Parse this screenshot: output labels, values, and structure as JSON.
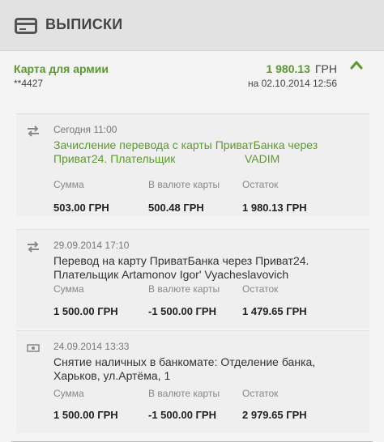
{
  "header": {
    "title": "ВЫПИСКИ",
    "icon": "credit-card-icon"
  },
  "account": {
    "name": "Карта для армии",
    "number": "**4427",
    "balance": "1 980.13",
    "currency": "ГРН",
    "date": "на 02.10.2014 12:56",
    "accent_color": "#5b9a2e"
  },
  "columns": {
    "sum": "Сумма",
    "card_currency": "В валюте карты",
    "rest": "Остаток"
  },
  "transactions": [
    {
      "icon": "transfer-arrows-icon",
      "date": "Сегодня 11:00",
      "desc1": "Зачисление перевода с карты ПриватБанка через",
      "desc2": "Приват24. Плательщик                      VADIM",
      "sum": "503.00 ГРН",
      "card_amount": "500.48 ГРН",
      "rest": "1 980.13 ГРН"
    },
    {
      "icon": "transfer-arrows-icon",
      "date": "29.09.2014 17:10",
      "desc1": "Перевод на карту ПриватБанка через Приват24.",
      "desc2": "Плательщик Artamonov Igor' Vyacheslavovich",
      "sum": "1 500.00 ГРН",
      "card_amount": "-1 500.00 ГРН",
      "rest": "1 479.65 ГРН"
    },
    {
      "icon": "cash-icon",
      "date": "24.09.2014 13:33",
      "desc1": "Снятие наличных в банкомате: Отделение банка,",
      "desc2": "Харьков, ул.Артёма, 1",
      "sum": "1 500.00 ГРН",
      "card_amount": "-1 500.00 ГРН",
      "rest": "2 979.65 ГРН"
    }
  ]
}
